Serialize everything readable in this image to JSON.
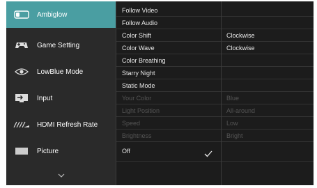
{
  "sidebar": {
    "items": [
      {
        "label": "Ambiglow",
        "icon": "ambiglow-icon",
        "active": true
      },
      {
        "label": "Game Setting",
        "icon": "gamepad-icon",
        "active": false
      },
      {
        "label": "LowBlue Mode",
        "icon": "eye-icon",
        "active": false
      },
      {
        "label": "Input",
        "icon": "input-icon",
        "active": false
      },
      {
        "label": "HDMI Refresh Rate",
        "icon": "hdmi-refresh-icon",
        "active": false
      },
      {
        "label": "Picture",
        "icon": "picture-icon",
        "active": false
      }
    ],
    "more_icon": "chevron-down-icon"
  },
  "options": [
    {
      "label": "Follow Video",
      "value": "",
      "enabled": true
    },
    {
      "label": "Follow Audio",
      "value": "",
      "enabled": true
    },
    {
      "label": "Color Shift",
      "value": "Clockwise",
      "enabled": true
    },
    {
      "label": "Color Wave",
      "value": "Clockwise",
      "enabled": true
    },
    {
      "label": "Color Breathing",
      "value": "",
      "enabled": true
    },
    {
      "label": "Starry Night",
      "value": "",
      "enabled": true
    },
    {
      "label": "Static Mode",
      "value": "",
      "enabled": true
    },
    {
      "label": "Your Color",
      "value": "Blue",
      "enabled": false
    },
    {
      "label": "Light Position",
      "value": "All-around",
      "enabled": false
    },
    {
      "label": "Speed",
      "value": "Low",
      "enabled": false
    },
    {
      "label": "Brightness",
      "value": "Bright",
      "enabled": false
    },
    {
      "label": "Off",
      "value": "",
      "enabled": true,
      "selected": true
    }
  ],
  "colors": {
    "accent": "#4a9ea2",
    "background": "#1c1c1c",
    "sidebar": "#2a2a2a",
    "text": "#e8e8e8",
    "disabled_text": "#555555"
  }
}
